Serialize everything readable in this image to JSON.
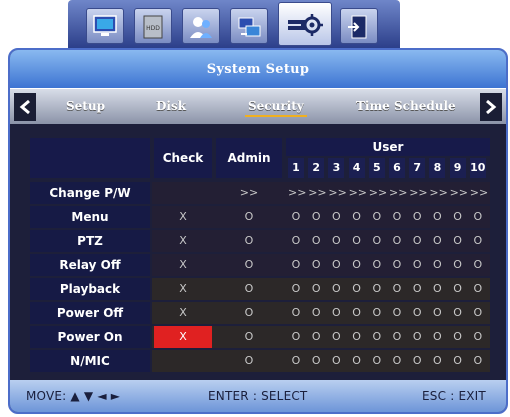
{
  "title": "System Setup",
  "tabs": [
    "Setup",
    "Disk",
    "Security",
    "Time Schedule"
  ],
  "selected_tab": "Security",
  "table": {
    "col_check": "Check",
    "col_admin": "Admin",
    "col_user": "User",
    "user_numbers": [
      "1",
      "2",
      "3",
      "4",
      "5",
      "6",
      "7",
      "8",
      "9",
      "10"
    ],
    "rows": [
      {
        "label": "Change P/W",
        "check": "",
        "admin": ">>",
        "user": ">>"
      },
      {
        "label": "Menu",
        "check": "X",
        "admin": "O",
        "user": "O"
      },
      {
        "label": "PTZ",
        "check": "X",
        "admin": "O",
        "user": "O"
      },
      {
        "label": "Relay Off",
        "check": "X",
        "admin": "O",
        "user": "O"
      },
      {
        "label": "Playback",
        "check": "X",
        "admin": "O",
        "user": "O"
      },
      {
        "label": "Power Off",
        "check": "X",
        "admin": "O",
        "user": "O"
      },
      {
        "label": "Power On",
        "check": "X",
        "admin": "O",
        "user": "O"
      },
      {
        "label": "N/MIC",
        "check": "",
        "admin": "O",
        "user": "O"
      }
    ]
  },
  "footer": {
    "move": "MOVE: ▲ ▼ ◄ ►",
    "enter": "ENTER : SELECT",
    "esc": "ESC : EXIT"
  },
  "icons": [
    "monitor-icon",
    "hdd-icon",
    "users-icon",
    "network-icon",
    "system-settings-icon",
    "exit-icon"
  ],
  "colors": {
    "accent": "#4c6dc9",
    "selected_cell": "#e02121",
    "tab_underline": "#f0b020"
  }
}
